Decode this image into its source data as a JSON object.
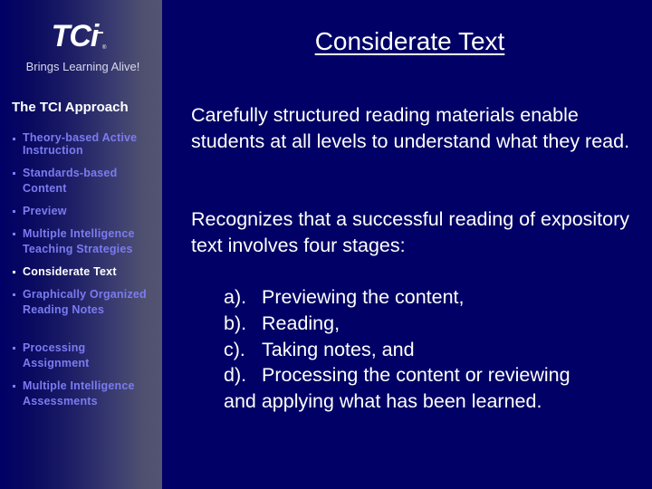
{
  "colors": {
    "background": "#000066",
    "sidebar_gradient_start": "#000066",
    "sidebar_gradient_end": "#535472",
    "nav_item": "#7b7bf0",
    "nav_item_active": "#ffffff",
    "text": "#ffffff"
  },
  "sidebar": {
    "logo": {
      "mark": "TCi",
      "registered": "®",
      "tagline": "Brings Learning Alive!"
    },
    "heading": "The TCI Approach",
    "items": [
      {
        "label": "Theory-based Active Instruction",
        "active": false
      },
      {
        "label": "Standards-based Content",
        "active": false
      },
      {
        "label": "Preview",
        "active": false
      },
      {
        "label": "Multiple Intelligence Teaching Strategies",
        "active": false
      },
      {
        "label": "Considerate Text",
        "active": true
      },
      {
        "label": "Graphically Organized Reading Notes",
        "active": false
      },
      {
        "label": "Processing Assignment",
        "active": false
      },
      {
        "label": "Multiple Intelligence Assessments",
        "active": false
      }
    ]
  },
  "main": {
    "title": "Considerate Text",
    "paragraphs": [
      "Carefully structured reading materials enable students at all levels to understand what they read.",
      "Recognizes that a successful reading of expository text involves four stages:"
    ],
    "stages": [
      {
        "letter": "a).",
        "text": "Previewing the content,"
      },
      {
        "letter": "b).",
        "text": "Reading,"
      },
      {
        "letter": "c).",
        "text": "Taking notes, and"
      },
      {
        "letter": "d).",
        "text": "Processing the content or reviewing"
      },
      {
        "letter": "",
        "text": "and applying what has been learned."
      }
    ]
  }
}
